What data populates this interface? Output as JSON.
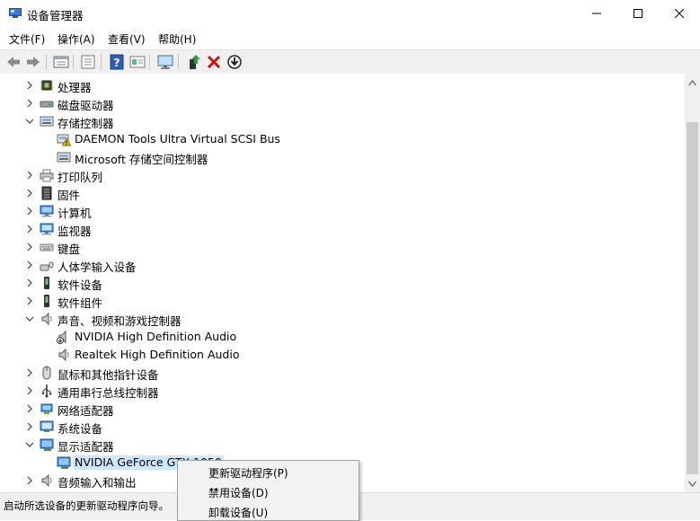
{
  "window": {
    "title": "设备管理器"
  },
  "menu": [
    "文件(F)",
    "操作(A)",
    "查看(V)",
    "帮助(H)"
  ],
  "toolbar": [
    "back-icon",
    "forward-icon",
    "properties-icon",
    "list-icon",
    "help-icon",
    "view-icon",
    "monitor-scan-icon",
    "update-driver-icon",
    "uninstall-icon",
    "download-icon"
  ],
  "tree": {
    "rows": [
      {
        "label": "处理器",
        "level": 0,
        "expander": "collapsed",
        "icon": "cpu-icon"
      },
      {
        "label": "磁盘驱动器",
        "level": 0,
        "expander": "collapsed",
        "icon": "disk-icon"
      },
      {
        "label": "存储控制器",
        "level": 0,
        "expander": "expanded",
        "icon": "storage-controller-icon"
      },
      {
        "label": "DAEMON Tools Ultra Virtual SCSI Bus",
        "level": 1,
        "expander": "none",
        "icon": "storage-warning-icon"
      },
      {
        "label": "Microsoft 存储空间控制器",
        "level": 1,
        "expander": "none",
        "icon": "storage-controller-icon"
      },
      {
        "label": "打印队列",
        "level": 0,
        "expander": "collapsed",
        "icon": "printer-icon"
      },
      {
        "label": "固件",
        "level": 0,
        "expander": "collapsed",
        "icon": "firmware-icon"
      },
      {
        "label": "计算机",
        "level": 0,
        "expander": "collapsed",
        "icon": "computer-icon"
      },
      {
        "label": "监视器",
        "level": 0,
        "expander": "collapsed",
        "icon": "monitor-icon"
      },
      {
        "label": "键盘",
        "level": 0,
        "expander": "collapsed",
        "icon": "keyboard-icon"
      },
      {
        "label": "人体学输入设备",
        "level": 0,
        "expander": "collapsed",
        "icon": "hid-icon"
      },
      {
        "label": "软件设备",
        "level": 0,
        "expander": "collapsed",
        "icon": "software-device-icon"
      },
      {
        "label": "软件组件",
        "level": 0,
        "expander": "collapsed",
        "icon": "software-component-icon"
      },
      {
        "label": "声音、视频和游戏控制器",
        "level": 0,
        "expander": "expanded",
        "icon": "speaker-icon"
      },
      {
        "label": "NVIDIA High Definition Audio",
        "level": 1,
        "expander": "none",
        "icon": "speaker-download-icon"
      },
      {
        "label": "Realtek High Definition Audio",
        "level": 1,
        "expander": "none",
        "icon": "speaker-icon"
      },
      {
        "label": "鼠标和其他指针设备",
        "level": 0,
        "expander": "collapsed",
        "icon": "mouse-icon"
      },
      {
        "label": "通用串行总线控制器",
        "level": 0,
        "expander": "collapsed",
        "icon": "usb-icon"
      },
      {
        "label": "网络适配器",
        "level": 0,
        "expander": "collapsed",
        "icon": "network-icon"
      },
      {
        "label": "系统设备",
        "level": 0,
        "expander": "collapsed",
        "icon": "system-device-icon"
      },
      {
        "label": "显示适配器",
        "level": 0,
        "expander": "expanded",
        "icon": "display-adapter-icon"
      },
      {
        "label": "NVIDIA GeForce GTX 1050",
        "level": 1,
        "expander": "none",
        "icon": "display-adapter-icon",
        "selected": true
      },
      {
        "label": "音频输入和输出",
        "level": 0,
        "expander": "collapsed",
        "icon": "speaker-icon"
      }
    ]
  },
  "status": {
    "text": "启动所选设备的更新驱动程序向导。"
  },
  "context_menu": {
    "items": [
      "更新驱动程序(P)",
      "禁用设备(D)",
      "卸载设备(U)"
    ]
  }
}
